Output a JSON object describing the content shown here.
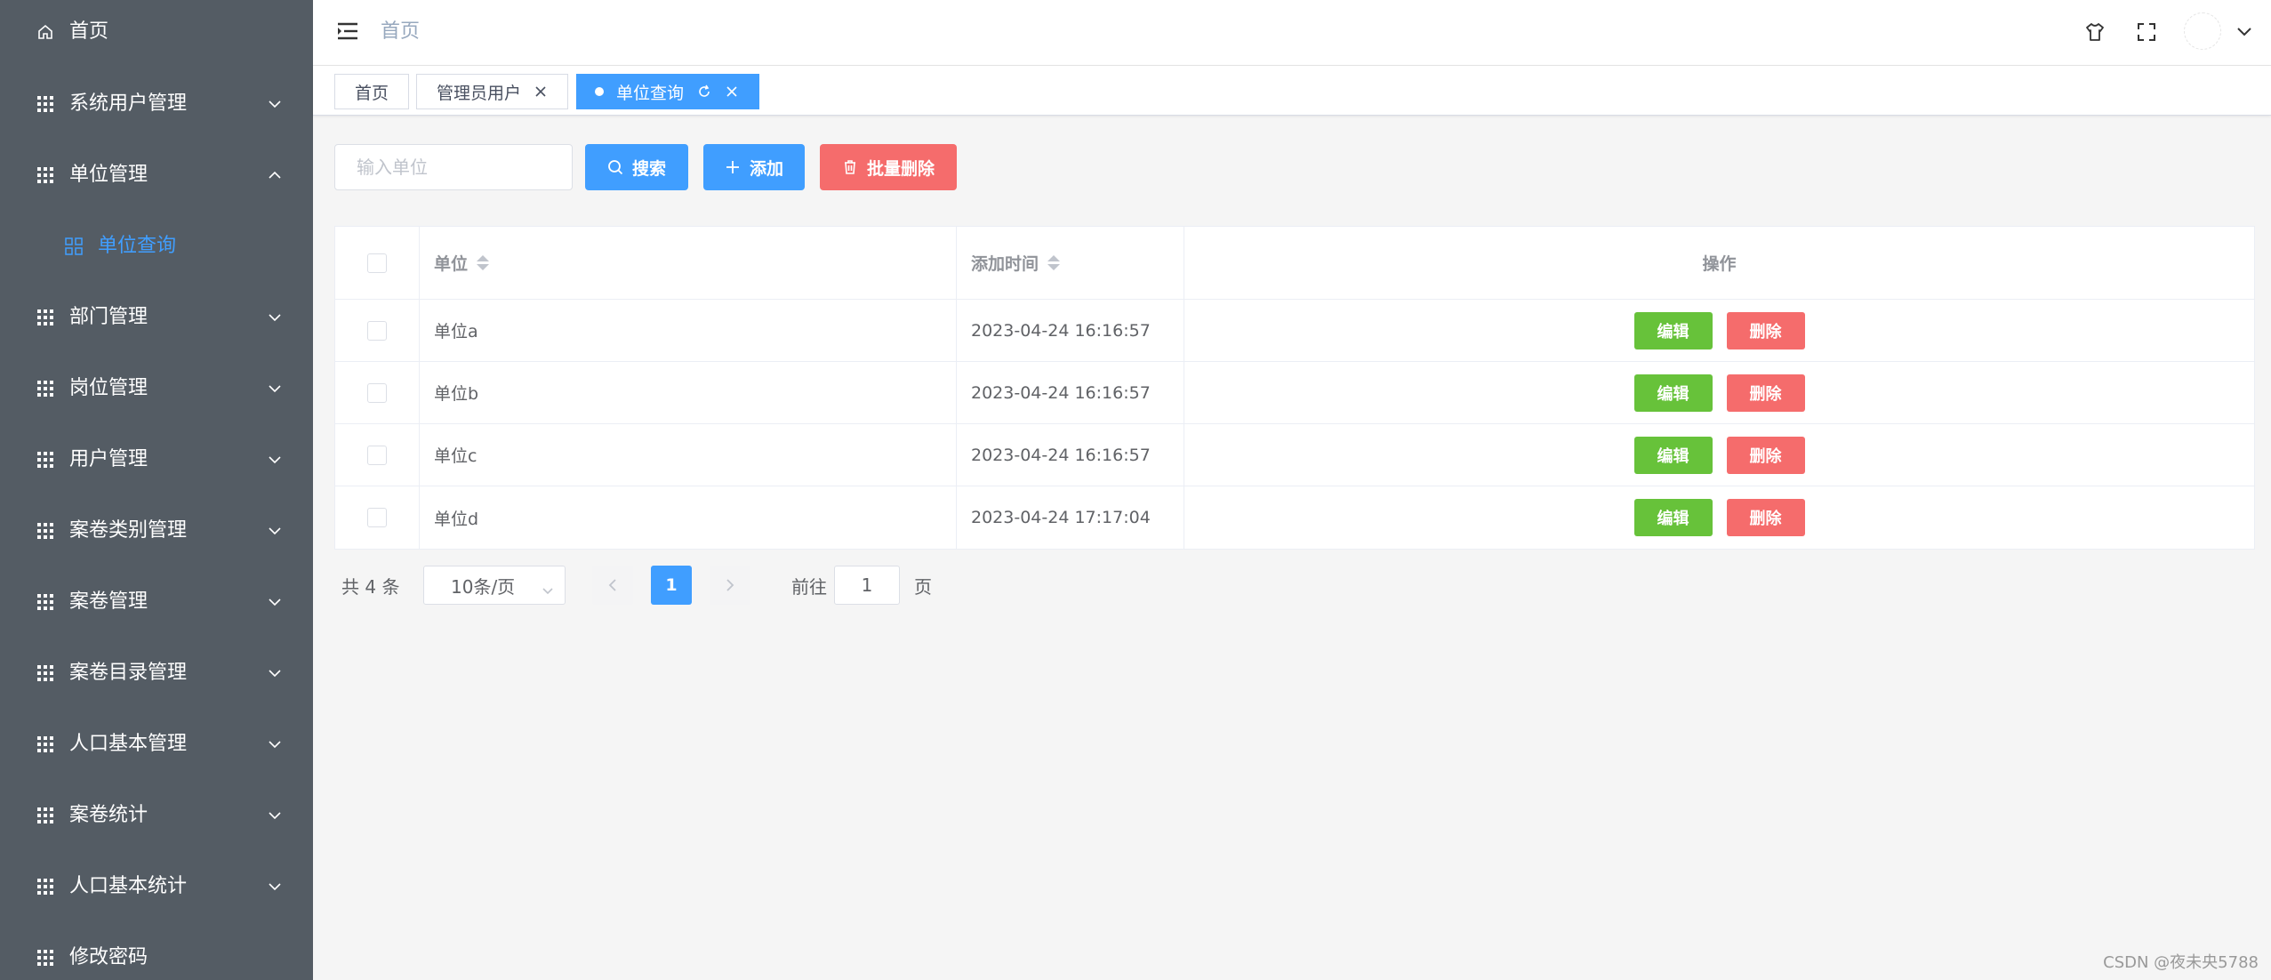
{
  "sidebar": {
    "home": "首页",
    "items": [
      {
        "label": "系统用户管理"
      },
      {
        "label": "单位管理"
      },
      {
        "label": "部门管理"
      },
      {
        "label": "岗位管理"
      },
      {
        "label": "用户管理"
      },
      {
        "label": "案卷类别管理"
      },
      {
        "label": "案卷管理"
      },
      {
        "label": "案卷目录管理"
      },
      {
        "label": "人口基本管理"
      },
      {
        "label": "案卷统计"
      },
      {
        "label": "人口基本统计"
      },
      {
        "label": "修改密码"
      }
    ],
    "submenu_active": "单位查询"
  },
  "header": {
    "title": "首页"
  },
  "tags": [
    {
      "label": "首页"
    },
    {
      "label": "管理员用户"
    },
    {
      "label": "单位查询"
    }
  ],
  "toolbar": {
    "search_placeholder": "输入单位",
    "search_label": "搜索",
    "add_label": "添加",
    "batch_delete_label": "批量删除"
  },
  "table": {
    "columns": {
      "unit": "单位",
      "time": "添加时间",
      "ops": "操作"
    },
    "rows": [
      {
        "unit": "单位a",
        "time": "2023-04-24 16:16:57"
      },
      {
        "unit": "单位b",
        "time": "2023-04-24 16:16:57"
      },
      {
        "unit": "单位c",
        "time": "2023-04-24 16:16:57"
      },
      {
        "unit": "单位d",
        "time": "2023-04-24 17:17:04"
      }
    ],
    "edit_label": "编辑",
    "delete_label": "删除"
  },
  "pagination": {
    "total": "共 4 条",
    "page_size": "10条/页",
    "current_page": "1",
    "goto_label": "前往",
    "goto_value": "1",
    "page_label": "页"
  },
  "watermark": "CSDN @夜未央5788",
  "colors": {
    "sidebar_bg": "#545c64",
    "primary": "#409eff",
    "danger": "#f56c6c",
    "success": "#67c23a"
  }
}
